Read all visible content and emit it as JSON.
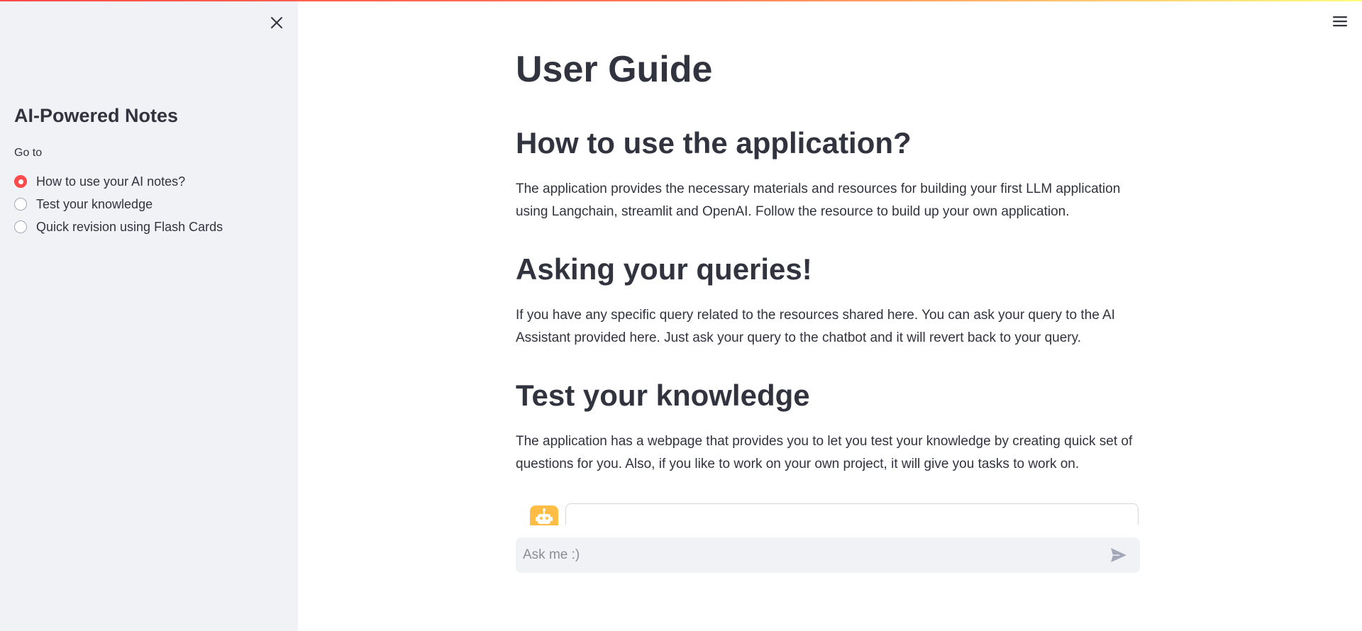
{
  "sidebar": {
    "close_icon": "close-icon",
    "title": "AI-Powered Notes",
    "radio_label": "Go to",
    "options": [
      {
        "label": "How to use your AI notes?",
        "selected": true
      },
      {
        "label": "Test your knowledge",
        "selected": false
      },
      {
        "label": "Quick revision using Flash Cards",
        "selected": false
      }
    ]
  },
  "header": {
    "menu_icon": "hamburger-menu-icon"
  },
  "main": {
    "title": "User Guide",
    "sections": [
      {
        "heading": "How to use the application?",
        "text": "The application provides the necessary materials and resources for building your first LLM application using Langchain, streamlit and OpenAI. Follow the resource to build up your own application."
      },
      {
        "heading": "Asking your queries!",
        "text": "If you have any specific query related to the resources shared here. You can ask your query to the AI Assistant provided here. Just ask your query to the chatbot and it will revert back to your query."
      },
      {
        "heading": "Test your knowledge",
        "text": "The application has a webpage that provides you to let you test your knowledge by creating quick set of questions for you. Also, if you like to work on your own project, it will give you tasks to work on."
      }
    ]
  },
  "chat": {
    "avatar_icon": "robot-icon",
    "placeholder": "Ask me :)",
    "value": "",
    "send_icon": "send-icon"
  },
  "colors": {
    "accent": "#ff4b4b",
    "sidebar_bg": "#f0f2f6",
    "text": "#31333f",
    "avatar_bg": "#ffbd45"
  }
}
